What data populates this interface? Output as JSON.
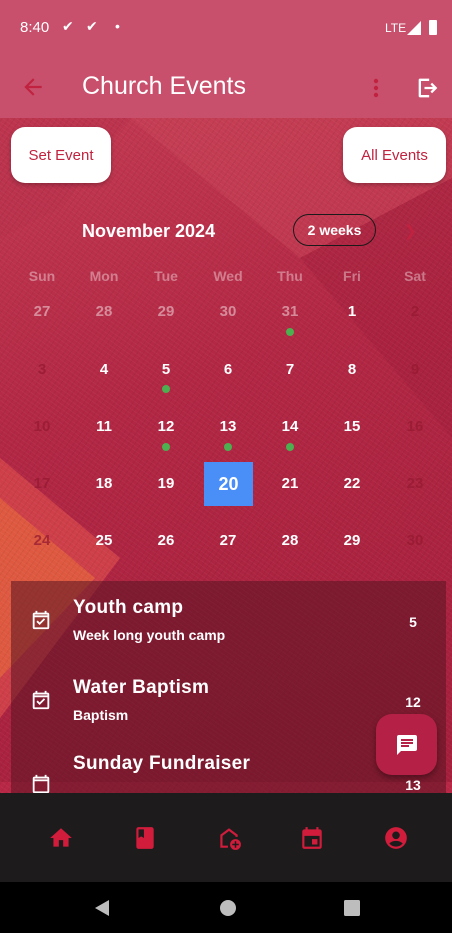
{
  "status_bar": {
    "time": "8:40",
    "check_icon": "✔",
    "dot": "•",
    "network": "LTE"
  },
  "app_bar": {
    "title": "Church Events",
    "back_icon": "arrow-left-icon",
    "more_icon": "more-vert-icon",
    "logout_icon": "logout-icon"
  },
  "actions": {
    "set_event": "Set Event",
    "all_events": "All Events"
  },
  "calendar": {
    "month": "November 2024",
    "format_button": "2 weeks",
    "next_icon": "❯",
    "weekdays": [
      "Sun",
      "Mon",
      "Tue",
      "Wed",
      "Thu",
      "Fri",
      "Sat"
    ],
    "weeks": [
      [
        "27",
        "28",
        "29",
        "30",
        "31",
        "1",
        "2"
      ],
      [
        "3",
        "4",
        "5",
        "6",
        "7",
        "8",
        "9"
      ],
      [
        "10",
        "11",
        "12",
        "13",
        "14",
        "15",
        "16"
      ],
      [
        "17",
        "18",
        "19",
        "20",
        "21",
        "22",
        "23"
      ],
      [
        "24",
        "25",
        "26",
        "27",
        "28",
        "29",
        "30"
      ]
    ],
    "selected_day": "20",
    "event_marker_color": "#4caf50",
    "selected_color": "#4a8ff7"
  },
  "events": [
    {
      "title": "Youth camp",
      "subtitle": "Week long youth camp",
      "count": "5"
    },
    {
      "title": "Water Baptism",
      "subtitle": "Baptism",
      "count": "12"
    },
    {
      "title": "Sunday Fundraiser",
      "subtitle": "",
      "count": "13"
    }
  ],
  "fab": {
    "icon": "chat-message-icon"
  },
  "bottom_nav": {
    "items": [
      "home-icon",
      "book-icon",
      "add-home-icon",
      "calendar-icon",
      "account-circle-icon"
    ],
    "accent": "#d11c3c"
  },
  "colors": {
    "primary": "#c0223f",
    "appbar": "#c8506c"
  }
}
